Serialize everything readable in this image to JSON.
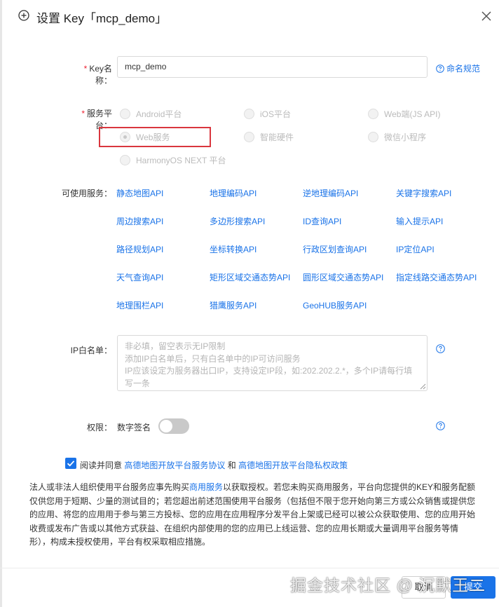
{
  "dialog": {
    "title": "设置 Key「mcp_demo」"
  },
  "key_name": {
    "label": "Key名称：",
    "value": "mcp_demo",
    "naming_link": "命名规范"
  },
  "platform": {
    "label": "服务平台：",
    "options": [
      {
        "label": "Android平台",
        "checked": false
      },
      {
        "label": "iOS平台",
        "checked": false
      },
      {
        "label": "Web端(JS API)",
        "checked": false
      },
      {
        "label": "Web服务",
        "checked": true
      },
      {
        "label": "智能硬件",
        "checked": false
      },
      {
        "label": "微信小程序",
        "checked": false
      },
      {
        "label": "HarmonyOS NEXT 平台",
        "checked": false
      }
    ]
  },
  "services": {
    "label": "可使用服务：",
    "items": [
      "静态地图API",
      "地理编码API",
      "逆地理编码API",
      "关键字搜索API",
      "周边搜索API",
      "多边形搜索API",
      "ID查询API",
      "输入提示API",
      "路径规划API",
      "坐标转换API",
      "行政区划查询API",
      "IP定位API",
      "天气查询API",
      "矩形区域交通态势API",
      "圆形区域交通态势API",
      "指定线路交通态势API",
      "地理围栏API",
      "猎鹰服务API",
      "GeoHUB服务API"
    ]
  },
  "ip_whitelist": {
    "label": "IP白名单：",
    "placeholder": "非必填，留空表示无IP限制\n添加IP白名单后，只有白名单中的IP可访问服务\nIP应该设定为服务器出口IP，支持设定IP段，如:202.202.2.*，多个IP请每行填写一条"
  },
  "permission": {
    "label": "权限：",
    "signature_label": "数字签名",
    "enabled": false
  },
  "agreement": {
    "prefix": "阅读并同意",
    "link1": "高德地图开放平台服务协议",
    "and": "和",
    "link2": "高德地图开放平台隐私权政策",
    "checked": true
  },
  "terms": {
    "part1": "法人或非法人组织使用平台服务应事先购买",
    "link": "商用服务",
    "part2": "以获取授权。若您未购买商用服务，平台向您提供的KEY和服务配额仅供您用于短期、少量的测试目的；若您超出前述范围使用平台服务（包括但不限于您开始向第三方或公众销售或提供您的应用、将您的应用用于参与第三方投标、您的应用在应用程序分发平台上架或已经可以被公众获取使用、您的应用开始收费或发布广告或以其他方式获益、在组织内部使用的您的应用已上线运营、您的应用长期或大量调用平台服务等情形），构成未授权使用，平台有权采取相应措施。"
  },
  "footer": {
    "cancel": "取消",
    "submit": "提交"
  },
  "watermark": "掘金技术社区 @ 沉默王二",
  "colors": {
    "accent": "#1a73e8",
    "highlight_border": "#d9363e",
    "required": "#ee2233"
  }
}
